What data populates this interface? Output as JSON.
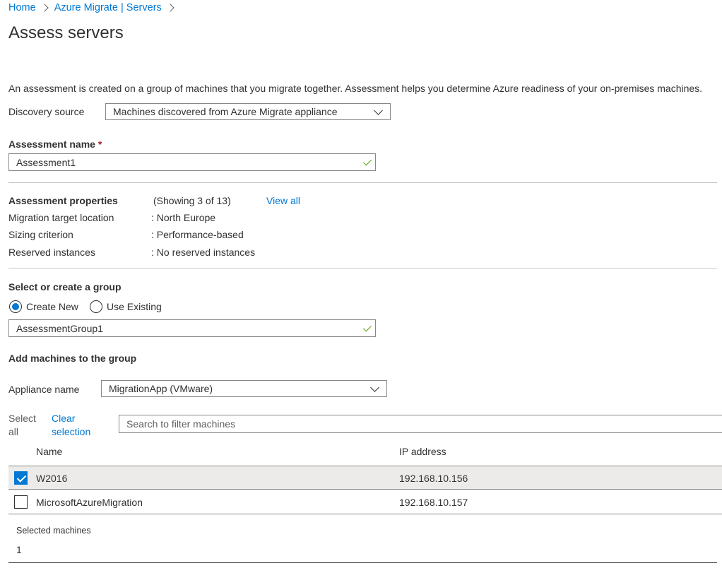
{
  "breadcrumb": {
    "home": "Home",
    "parent": "Azure Migrate | Servers"
  },
  "page": {
    "title": "Assess servers",
    "description": "An assessment is created on a group of machines that you migrate together. Assessment helps you determine Azure readiness of your on-premises machines."
  },
  "discovery": {
    "label": "Discovery source",
    "value": "Machines discovered from Azure Migrate appliance"
  },
  "assessment_name": {
    "label": "Assessment name",
    "required_mark": "*",
    "value": "Assessment1"
  },
  "properties": {
    "title": "Assessment properties",
    "showing": "(Showing 3 of 13)",
    "view_all": "View all",
    "items": [
      {
        "label": "Migration target location",
        "value": ": North Europe"
      },
      {
        "label": "Sizing criterion",
        "value": ": Performance-based"
      },
      {
        "label": "Reserved instances",
        "value": ": No reserved instances"
      }
    ]
  },
  "group": {
    "title": "Select or create a group",
    "create_new": "Create New",
    "use_existing": "Use Existing",
    "selected_option": "Create New",
    "name_value": "AssessmentGroup1"
  },
  "machines": {
    "title": "Add machines to the group",
    "appliance_label": "Appliance name",
    "appliance_value": "MigrationApp (VMware)",
    "select_all_line1": "Select",
    "select_all_line2": "all",
    "clear_line1": "Clear",
    "clear_line2": "selection",
    "search_placeholder": "Search to filter machines",
    "columns": {
      "name": "Name",
      "ip": "IP address"
    },
    "rows": [
      {
        "name": "W2016",
        "ip": "192.168.10.156",
        "checked": true
      },
      {
        "name": "MicrosoftAzureMigration",
        "ip": "192.168.10.157",
        "checked": false
      }
    ]
  },
  "summary": {
    "label": "Selected machines",
    "value": "1"
  },
  "colors": {
    "accent": "#0078d4",
    "success": "#57a300",
    "required": "#a4262c"
  }
}
